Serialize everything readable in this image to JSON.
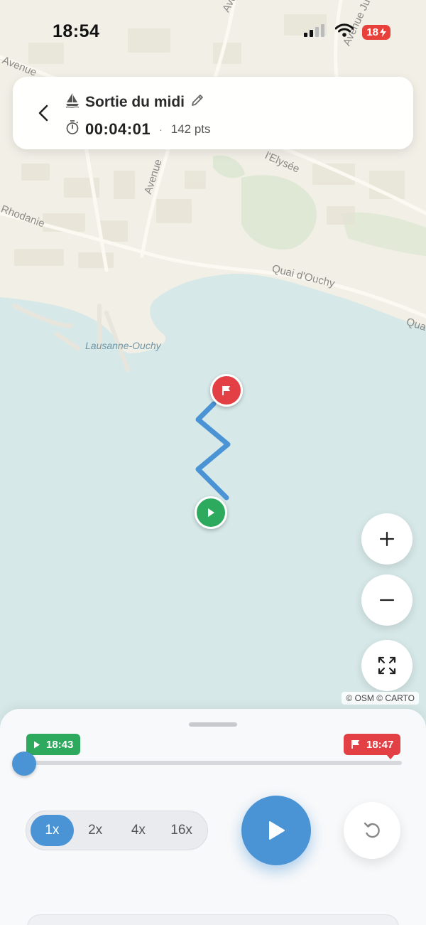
{
  "status_bar": {
    "time": "18:54",
    "battery": "18"
  },
  "header": {
    "title": "Sortie du midi",
    "duration": "00:04:01",
    "separator": "·",
    "points": "142 pts"
  },
  "map": {
    "labels": {
      "avenue_top": "Avenue",
      "avenue_left": "Avenue",
      "avenue_mid": "Avenue",
      "avenue_right": "Avenue Ju",
      "elysee": "l'Elysée",
      "rhodanie": "Rhodanie",
      "quai": "Quai d'Ouchy",
      "quai_right": "Qua",
      "port": "Lausanne-Ouchy"
    },
    "attribution": "© OSM © CARTO",
    "route_color": "#4a94d6",
    "start_color": "#2eaa5e",
    "end_color": "#e24045",
    "water_color": "#d6e8e8"
  },
  "controls": {
    "zoom_in": "+",
    "zoom_out": "−"
  },
  "playback": {
    "start_time": "18:43",
    "end_time": "18:47",
    "progress": 0,
    "speeds": [
      "1x",
      "2x",
      "4x",
      "16x"
    ],
    "active_speed": "1x"
  }
}
